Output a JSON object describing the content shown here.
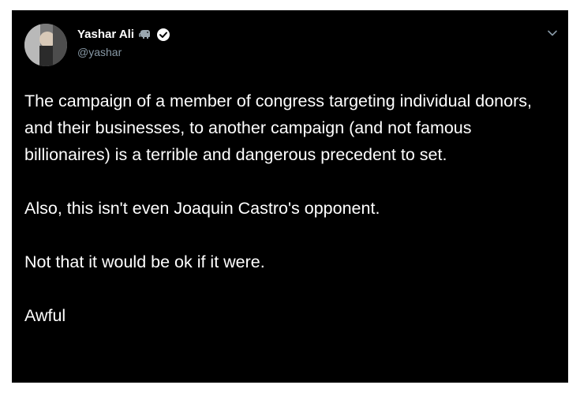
{
  "tweet": {
    "author": {
      "display_name": "Yashar Ali",
      "handle": "@yashar",
      "badges": [
        "elephant-icon",
        "verified-icon"
      ]
    },
    "menu_icon": "chevron-down-icon",
    "paragraphs": [
      "The campaign of a member of congress targeting individual donors, and their businesses, to another campaign (and not famous billionaires) is a terrible and dangerous precedent to set.",
      "Also, this isn't even Joaquin Castro's opponent.",
      "Not that it would be ok if it were.",
      "Awful"
    ]
  },
  "colors": {
    "card_background": "#000000",
    "text_primary": "#ffffff",
    "text_secondary": "#8899a6",
    "verified_badge": "#ffffff"
  }
}
